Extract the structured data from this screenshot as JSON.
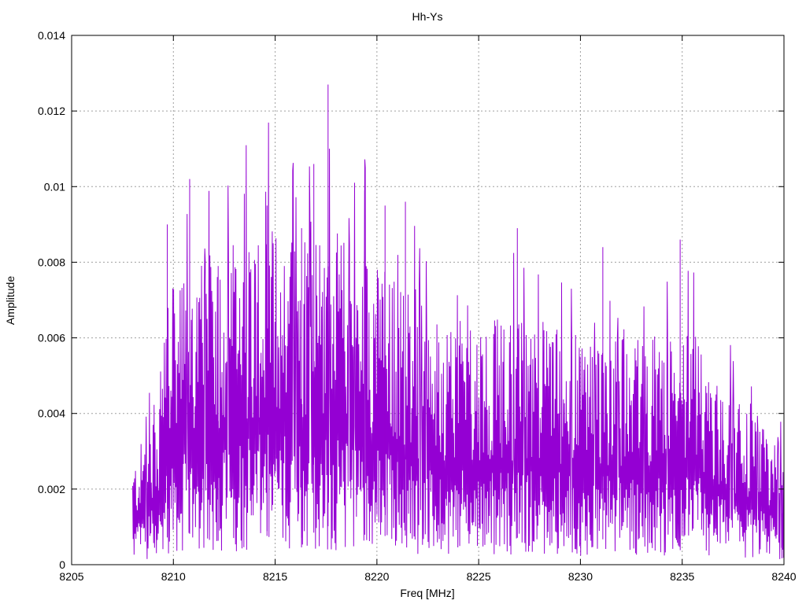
{
  "chart_data": {
    "type": "line",
    "title": "Hh-Ys",
    "xlabel": "Freq [MHz]",
    "ylabel": "Amplitude",
    "xlim": [
      8205,
      8240
    ],
    "ylim": [
      0,
      0.014
    ],
    "grid": true,
    "x_ticks": [
      "8205",
      "8210",
      "8215",
      "8220",
      "8225",
      "8230",
      "8235",
      "8240"
    ],
    "y_ticks": [
      "0",
      "0.002",
      "0.004",
      "0.006",
      "0.008",
      "0.01",
      "0.012",
      "0.014"
    ],
    "series": [
      {
        "color": "#9400d3",
        "x_start": 8208.0,
        "x_end": 8240.0,
        "peaks": [
          {
            "x": 8209.7,
            "y": 0.009
          },
          {
            "x": 8210.8,
            "y": 0.0102
          },
          {
            "x": 8212.2,
            "y": 0.0079
          },
          {
            "x": 8214.6,
            "y": 0.0095
          },
          {
            "x": 8216.3,
            "y": 0.0089
          },
          {
            "x": 8216.9,
            "y": 0.0106
          },
          {
            "x": 8217.6,
            "y": 0.0127
          },
          {
            "x": 8219.4,
            "y": 0.0099
          },
          {
            "x": 8220.4,
            "y": 0.0095
          },
          {
            "x": 8221.4,
            "y": 0.0096
          },
          {
            "x": 8226.9,
            "y": 0.0089
          },
          {
            "x": 8231.1,
            "y": 0.0084
          },
          {
            "x": 8234.9,
            "y": 0.0086
          },
          {
            "x": 8239.9,
            "y": 0.0021
          }
        ]
      }
    ]
  }
}
